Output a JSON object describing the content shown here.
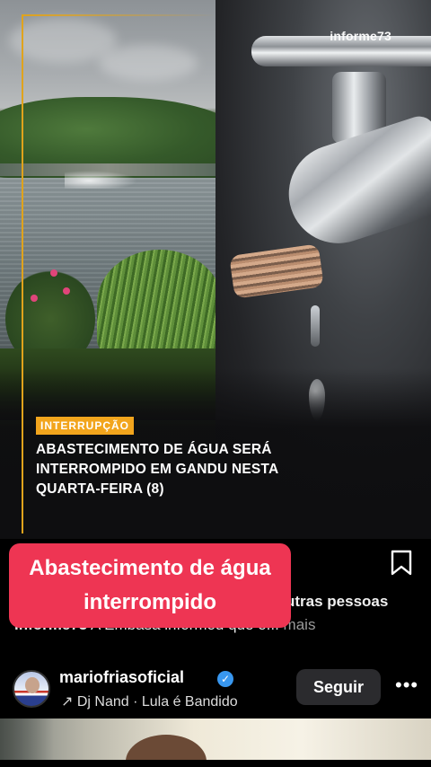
{
  "post": {
    "watermark": "informe73",
    "badge": "INTERRUPÇÃO",
    "headline": "ABASTECIMENTO DE ÁGUA SERÁ INTERROMPIDO EM GANDU NESTA QUARTA-FEIRA (8)",
    "accent_color": "#f2a51d"
  },
  "overlay": {
    "label": "Abastecimento de água interrompido",
    "color": "#ee3553"
  },
  "caption": {
    "line1_visible": "utras pessoas",
    "line2_author": "informe73",
    "line2_text": " A Embasa informou que o...",
    "more": " mais"
  },
  "author": {
    "username": "mariofriasoficial",
    "music": "↗ Dj Nand · Lula é Bandido",
    "follow_label": "Seguir",
    "more_label": "•••"
  },
  "icons": {
    "bookmark": "bookmark-icon",
    "verified": "verified-badge-icon",
    "more": "more-options-icon"
  }
}
